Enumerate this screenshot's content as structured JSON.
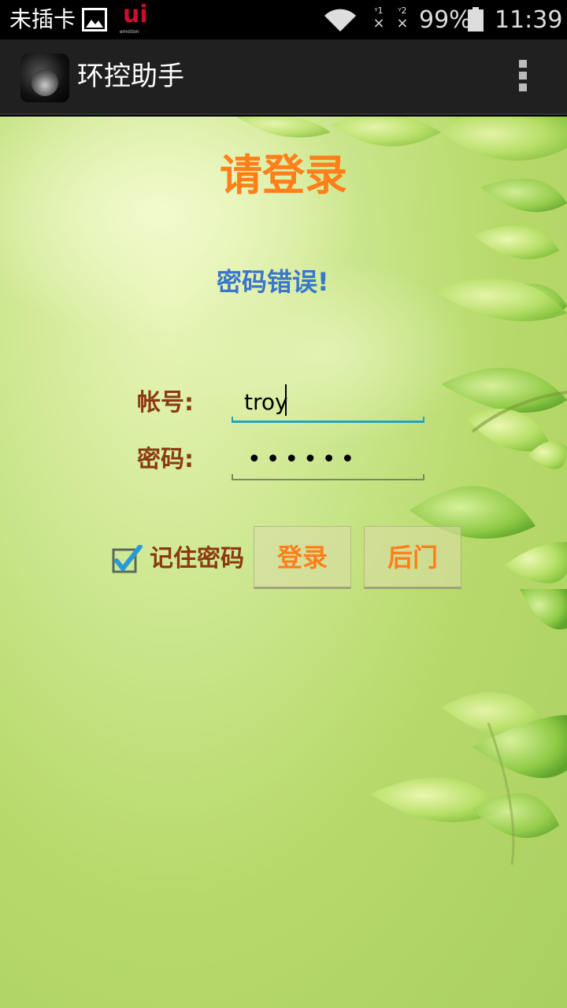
{
  "status_bar": {
    "carrier": "未插卡",
    "sim1": "1",
    "sim2": "2",
    "battery": "99%",
    "time": "11:39",
    "ui_emotion_big": "ui",
    "ui_emotion_small": "emotion"
  },
  "action_bar": {
    "title": "环控助手"
  },
  "login": {
    "title": "请登录",
    "error": "密码错误!",
    "account_label": "帐号:",
    "account_value": "troy",
    "password_label": "密码:",
    "password_value": "••••••",
    "remember_label": "记住密码",
    "remember_checked": true,
    "login_button": "登录",
    "backdoor_button": "后门"
  },
  "colors": {
    "title": "#ff7f1a",
    "error": "#3a76c9",
    "label": "#8a3a12",
    "focus_line": "#23a3c7",
    "checkbox_check": "#2a9ad6"
  }
}
